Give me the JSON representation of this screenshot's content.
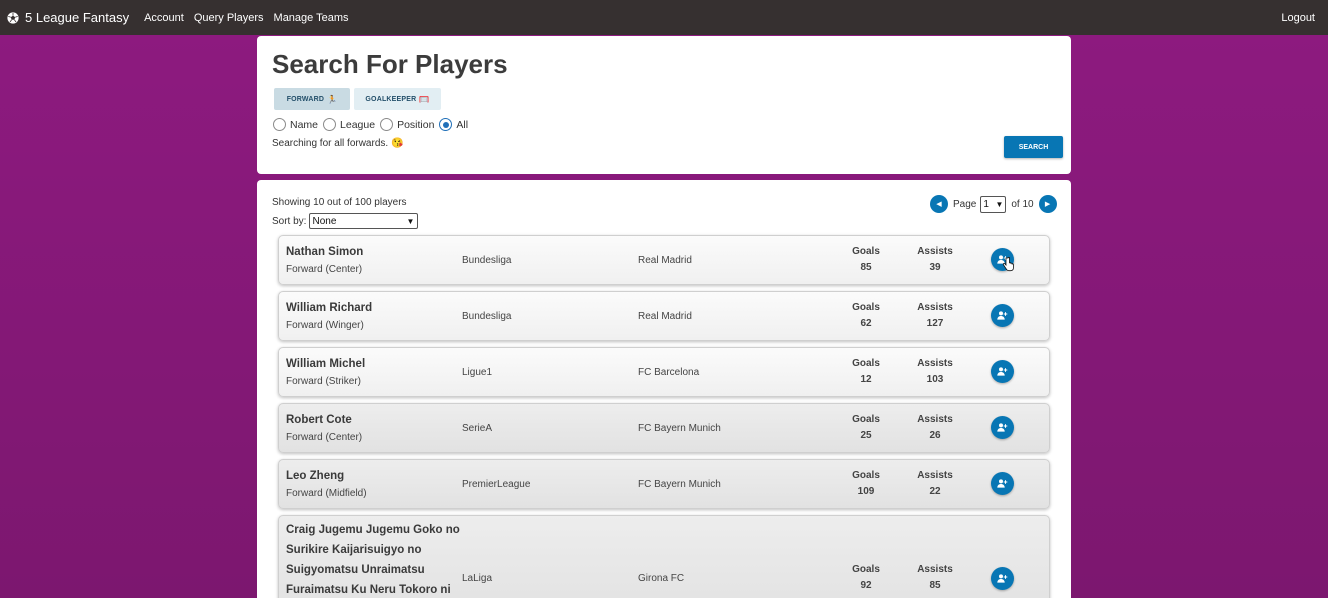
{
  "navbar": {
    "brand": "5 League Fantasy",
    "links": [
      "Account",
      "Query Players",
      "Manage Teams"
    ],
    "logout": "Logout"
  },
  "search": {
    "title": "Search For Players",
    "chips": [
      {
        "label": "FORWARD",
        "emoji": "🏃"
      },
      {
        "label": "GOALKEEPER",
        "emoji": "🥅"
      }
    ],
    "radio_options": [
      "Name",
      "League",
      "Position",
      "All"
    ],
    "selected_radio": "All",
    "status": "Searching for all forwards. 😘",
    "button": "SEARCH"
  },
  "results": {
    "showing": "Showing 10 out of 100 players",
    "sort_label": "Sort by:",
    "sort_value": "None",
    "page_label": "Page",
    "page_value": "1",
    "of_label": "of 10",
    "stat_labels": {
      "goals": "Goals",
      "assists": "Assists"
    },
    "players": [
      {
        "name": "Nathan Simon",
        "position": "Forward (Center)",
        "league": "Bundesliga",
        "club": "Real Madrid",
        "goals": "85",
        "assists": "39"
      },
      {
        "name": "William Richard",
        "position": "Forward (Winger)",
        "league": "Bundesliga",
        "club": "Real Madrid",
        "goals": "62",
        "assists": "127"
      },
      {
        "name": "William Michel",
        "position": "Forward (Striker)",
        "league": "Ligue1",
        "club": "FC Barcelona",
        "goals": "12",
        "assists": "103"
      },
      {
        "name": "Robert Cote",
        "position": "Forward (Center)",
        "league": "SerieA",
        "club": "FC Bayern Munich",
        "goals": "25",
        "assists": "26"
      },
      {
        "name": "Leo Zheng",
        "position": "Forward (Midfield)",
        "league": "PremierLeague",
        "club": "FC Bayern Munich",
        "goals": "109",
        "assists": "22"
      },
      {
        "name": "Craig Jugemu Jugemu Goko no Surikire Kaijarisuigyo no Suigyomatsu Unraimatsu Furaimatsu Ku Neru Tokoro ni",
        "position": "",
        "league": "LaLiga",
        "club": "Girona FC",
        "goals": "92",
        "assists": "85"
      }
    ]
  },
  "colors": {
    "navbar": "#363030",
    "background": "#8e1a80",
    "accent": "#0876b4"
  },
  "icons": [
    "soccer-ball-icon",
    "add-player-icon",
    "chevron-left-icon",
    "chevron-right-icon",
    "hand-cursor-icon"
  ]
}
